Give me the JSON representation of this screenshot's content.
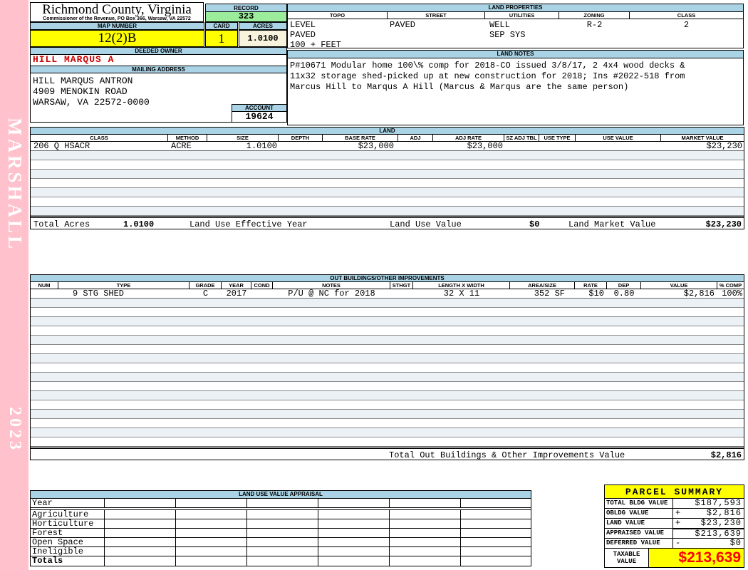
{
  "sidebar": {
    "top_text": "MARSHALL",
    "bottom_text": "2023"
  },
  "header": {
    "county": "Richmond County, Virginia",
    "commissioner_line": "Commissioner of the Revenue, PO Box 366, Warsaw, VA 22572",
    "record_label": "RECORD",
    "record_value": "323",
    "map_number_label": "MAP NUMBER",
    "map_number": "12(2)B",
    "card_label": "CARD",
    "card": "1",
    "acres_label": "ACRES",
    "acres": "1.0100"
  },
  "land_properties": {
    "title": "LAND PROPERTIES",
    "columns": [
      "TOPO",
      "STREET",
      "UTILITIES",
      "ZONING",
      "CLASS"
    ],
    "rows": [
      [
        "LEVEL",
        "PAVED",
        "WELL",
        "R-2",
        "2"
      ],
      [
        "PAVED",
        "",
        "SEP SYS",
        "",
        ""
      ],
      [
        "100 + FEET",
        "",
        "",
        "",
        ""
      ]
    ]
  },
  "owner": {
    "deeded_owner_label": "DEEDED OWNER",
    "deeded_owner": "HILL MARQUS A",
    "mailing_address_label": "MAILING ADDRESS",
    "address_lines": [
      "HILL MARQUS ANTRON",
      "4909 MENOKIN ROAD",
      "",
      "WARSAW, VA 22572-0000"
    ],
    "account_label": "ACCOUNT",
    "account": "19624"
  },
  "land_notes": {
    "title": "LAND NOTES",
    "lines": [
      "P#10671 Modular home 100\\% comp for 2018-CO issued 3/8/17, 2 4x4 wood decks &",
      "11x32 storage shed-picked up at new construction for 2018; Ins #2022-518 from",
      "Marcus Hill to Marqus A Hill (Marcus & Marqus are the same person)"
    ]
  },
  "land": {
    "title": "LAND",
    "columns": [
      "CLASS",
      "METHOD",
      "SIZE",
      "DEPTH",
      "BASE RATE",
      "ADJ",
      "ADJ RATE",
      "SZ ADJ TBL",
      "USE TYPE",
      "USE VALUE",
      "MARKET VALUE"
    ],
    "rows": [
      [
        "206 Q HSACR",
        "ACRE",
        "1.0100",
        "",
        "$23,000",
        "",
        "$23,000",
        "",
        "",
        "",
        "$23,230"
      ]
    ],
    "totals": {
      "total_acres_label": "Total Acres",
      "total_acres": "1.0100",
      "effective_year_label": "Land Use Effective Year",
      "use_value_label": "Land Use Value",
      "use_value": "$0",
      "market_value_label": "Land Market Value",
      "market_value": "$23,230"
    }
  },
  "out_buildings": {
    "title": "OUT BUILDINGS/OTHER IMPROVEMENTS",
    "columns": [
      "NUM",
      "TYPE",
      "GRADE",
      "YEAR",
      "COND",
      "NOTES",
      "STHGT",
      "LENGTH X WIDTH",
      "AREA/SIZE",
      "RATE",
      "DEP",
      "VALUE",
      "% COMP"
    ],
    "rows": [
      [
        "",
        "9 STG SHED",
        "C",
        "2017",
        "",
        "P/U @ NC for 2018",
        "",
        "32 X 11",
        "352 SF",
        "$10",
        "0.80",
        "$2,816",
        "100%"
      ]
    ],
    "total_label": "Total Out Buildings & Other Improvements Value",
    "total_value": "$2,816"
  },
  "land_use_appraisal": {
    "title": "LAND USE VALUE APPRAISAL",
    "row_labels": [
      "Year",
      "Agriculture",
      "Horticulture",
      "Forest",
      "Open Space",
      "Ineligible",
      "Totals"
    ],
    "num_data_columns": 6
  },
  "parcel_summary": {
    "title": "PARCEL SUMMARY",
    "rows": [
      {
        "label": "TOTAL BLDG VALUE",
        "op": "",
        "value": "$187,593"
      },
      {
        "label": "OBLDG VALUE",
        "op": "+",
        "value": "$2,816"
      },
      {
        "label": "LAND VALUE",
        "op": "+",
        "value": "$23,230"
      },
      {
        "label": "APPRAISED VALUE",
        "op": "",
        "value": "$213,639"
      },
      {
        "label": "DEFERRED VALUE",
        "op": "-",
        "value": "$0"
      }
    ],
    "taxable_label_line1": "TAXABLE",
    "taxable_label_line2": "VALUE",
    "taxable_value": "$213,639"
  },
  "colors": {
    "binder_pink": "#FFC2CD",
    "section_bar_blue": "#AAD4E6",
    "record_green": "#9BEC9B",
    "highlight_yellow": "#FFFF00",
    "acres_cream": "#F7F3DC",
    "owner_red": "#CC0000",
    "taxable_red": "#FF0000"
  }
}
